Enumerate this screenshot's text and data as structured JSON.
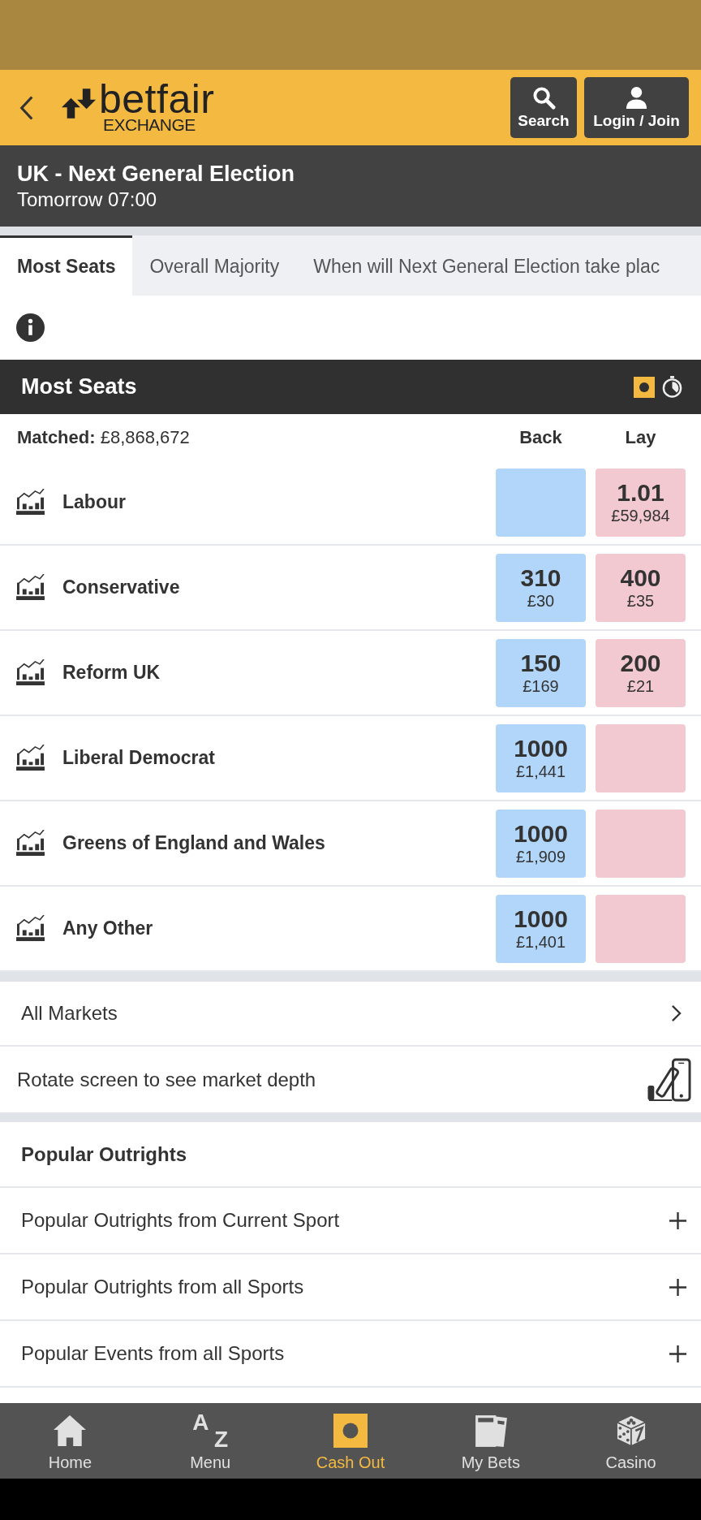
{
  "header": {
    "logo": {
      "wordmark": "betfair",
      "subtitle": "EXCHANGE"
    },
    "buttons": [
      {
        "kind": "search",
        "label": "Search"
      },
      {
        "kind": "account",
        "label": "Login / Join"
      }
    ]
  },
  "event": {
    "title": "UK - Next General Election",
    "time": "Tomorrow 07:00"
  },
  "tabs": [
    {
      "label": "Most Seats",
      "selected": true
    },
    {
      "label": "Overall Majority",
      "selected": false
    },
    {
      "label": "When will Next General Election take plac",
      "selected": false
    }
  ],
  "market": {
    "title": "Most Seats",
    "matched": "**Matched:** £8,868,672",
    "columns": [
      "Back",
      "Lay"
    ],
    "runners": [
      {
        "name": "Labour",
        "lay": {
          "price": "1.01",
          "stake": "£59,984"
        }
      },
      {
        "name": "Conservative",
        "back": {
          "price": "310",
          "stake": "£30"
        },
        "lay": {
          "price": "400",
          "stake": "£35"
        }
      },
      {
        "name": "Reform UK",
        "back": {
          "price": "150",
          "stake": "£169"
        },
        "lay": {
          "price": "200",
          "stake": "£21"
        }
      },
      {
        "name": "Liberal Democrat",
        "back": {
          "price": "1000",
          "stake": "£1,441"
        }
      },
      {
        "name": "Greens of England and Wales",
        "back": {
          "price": "1000",
          "stake": "£1,909"
        }
      },
      {
        "name": "Any Other",
        "back": {
          "price": "1000",
          "stake": "£1,401"
        }
      }
    ]
  },
  "links": [
    {
      "kind": "link",
      "label": "All Markets"
    },
    {
      "kind": "rotate",
      "label": "Rotate screen to see market depth"
    }
  ],
  "popular": {
    "title": "Popular Outrights",
    "items": [
      {
        "label": "Popular Outrights from Current Sport",
        "expanded": false
      },
      {
        "label": "Popular Outrights from all Sports",
        "expanded": false
      },
      {
        "label": "Popular Events from all Sports",
        "expanded": false
      }
    ]
  },
  "bottom_nav": [
    {
      "kind": "home",
      "label": "Home",
      "highlighted": false
    },
    {
      "kind": "menu",
      "label": "Menu",
      "glyphs": [
        "A",
        "Z"
      ],
      "highlighted": false
    },
    {
      "kind": "cashout",
      "label": "Cash Out",
      "highlighted": true
    },
    {
      "kind": "bets",
      "label": "My Bets",
      "highlighted": false
    },
    {
      "kind": "casino",
      "label": "Casino",
      "highlighted": false
    }
  ]
}
